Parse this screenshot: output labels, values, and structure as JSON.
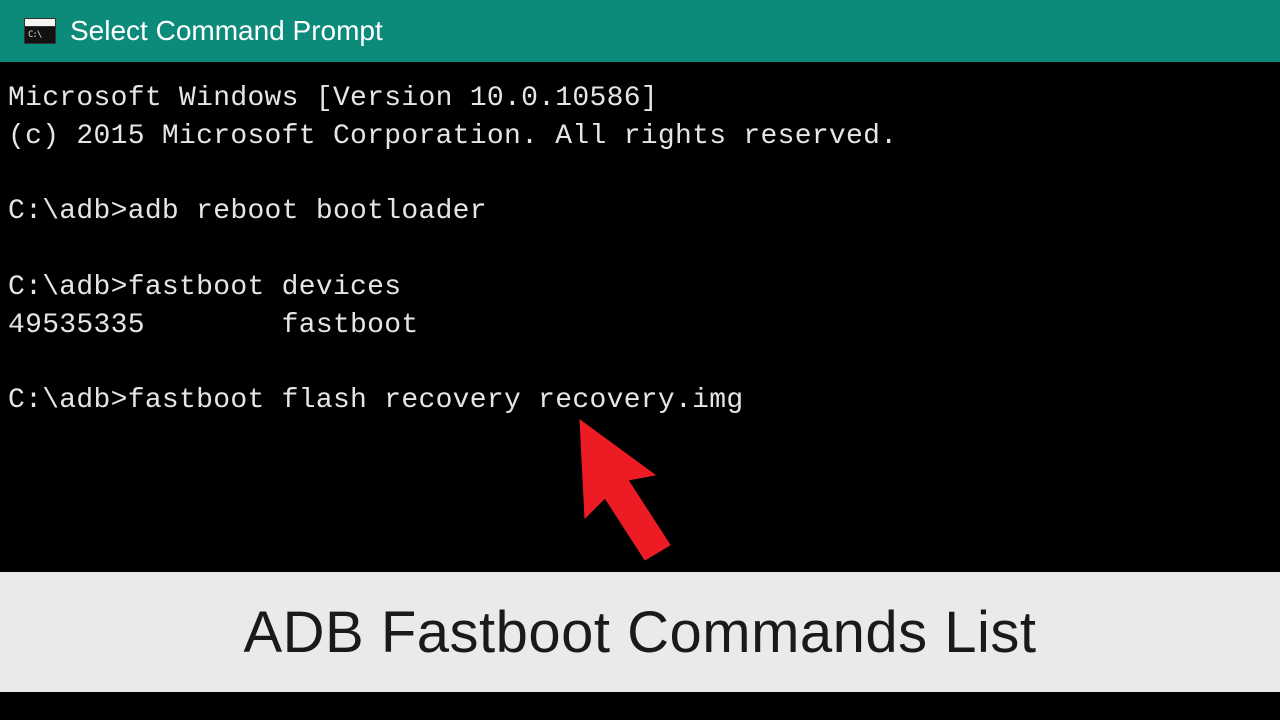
{
  "titlebar": {
    "icon_glyph": "C:\\",
    "title": "Select Command Prompt"
  },
  "terminal": {
    "lines": [
      "Microsoft Windows [Version 10.0.10586]",
      "(c) 2015 Microsoft Corporation. All rights reserved.",
      "",
      "C:\\adb>adb reboot bootloader",
      "",
      "C:\\adb>fastboot devices",
      "49535335        fastboot",
      "",
      "C:\\adb>fastboot flash recovery recovery.img"
    ]
  },
  "banner": {
    "text": "ADB Fastboot Commands List"
  }
}
